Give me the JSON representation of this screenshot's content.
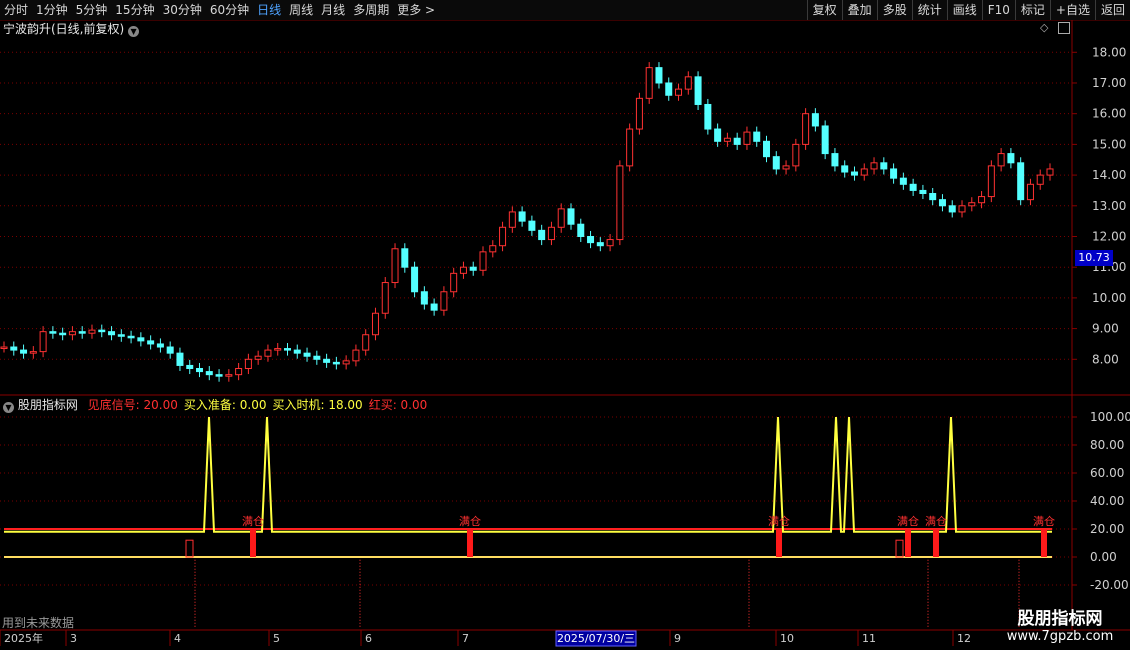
{
  "toolbar": {
    "periods": [
      "分时",
      "1分钟",
      "5分钟",
      "15分钟",
      "30分钟",
      "60分钟",
      "日线",
      "周线",
      "月线",
      "多周期",
      "更多 >"
    ],
    "active_period": "日线",
    "actions": [
      "复权",
      "叠加",
      "多股",
      "统计",
      "画线",
      "F10",
      "标记",
      "+自选",
      "返回"
    ]
  },
  "main_panel": {
    "title": "宁波韵升(日线,前复权)",
    "price_axis": [
      "18.00",
      "17.00",
      "16.00",
      "15.00",
      "14.00",
      "13.00",
      "12.00",
      "11.00",
      "10.00",
      "9.00",
      "8.00"
    ],
    "current_price_tag": "10.73"
  },
  "indicator_panel": {
    "name": "股朋指标网",
    "values": [
      {
        "label": "见底信号: 20.00",
        "color": "#ff3030"
      },
      {
        "label": "买入准备: 0.00",
        "color": "#ffff40"
      },
      {
        "label": "买入时机: 18.00",
        "color": "#ffff40"
      },
      {
        "label": "红买: 0.00",
        "color": "#ff3030"
      }
    ],
    "axis": [
      "100.00",
      "80.00",
      "60.00",
      "40.00",
      "20.00",
      "0.00",
      "-20.00"
    ],
    "signal_text": "满仓"
  },
  "date_axis": {
    "labels": [
      "2025年",
      "3",
      "4",
      "5",
      "6",
      "7",
      "9",
      "10",
      "11",
      "12"
    ],
    "cursor_date": "2025/07/30/三"
  },
  "footer": {
    "future_note": "用到未来数据"
  },
  "watermark": {
    "line1": "股朋指标网",
    "line2": "www.7gpzb.com"
  },
  "colors": {
    "up": "#ff3232",
    "down": "#54ffff",
    "axis": "#8a0000",
    "grid": "#7a0000",
    "signal_line": "#ffff40"
  },
  "chart_data": {
    "type": "candlestick",
    "title": "宁波韵升(日线,前复权)",
    "ylim": [
      7.0,
      18.4
    ],
    "close_series": [
      8.4,
      8.3,
      8.2,
      8.25,
      8.9,
      8.85,
      8.8,
      8.9,
      8.85,
      8.95,
      8.9,
      8.8,
      8.75,
      8.7,
      8.6,
      8.5,
      8.4,
      8.2,
      7.8,
      7.7,
      7.6,
      7.5,
      7.45,
      7.5,
      7.7,
      8.0,
      8.1,
      8.3,
      8.35,
      8.3,
      8.2,
      8.1,
      8.0,
      7.9,
      7.85,
      7.95,
      8.3,
      8.8,
      9.5,
      10.5,
      11.6,
      11.0,
      10.2,
      9.8,
      9.6,
      10.2,
      10.8,
      11.0,
      10.9,
      11.5,
      11.7,
      12.3,
      12.8,
      12.5,
      12.2,
      11.9,
      12.3,
      12.9,
      12.4,
      12.0,
      11.8,
      11.7,
      11.9,
      14.3,
      15.5,
      16.5,
      17.5,
      17.0,
      16.6,
      16.8,
      17.2,
      16.3,
      15.5,
      15.1,
      15.2,
      15.0,
      15.4,
      15.1,
      14.6,
      14.2,
      14.3,
      15.0,
      16.0,
      15.6,
      14.7,
      14.3,
      14.1,
      14.0,
      14.2,
      14.4,
      14.2,
      13.9,
      13.7,
      13.5,
      13.4,
      13.2,
      13.0,
      12.8,
      13.0,
      13.1,
      13.3,
      14.3,
      14.7,
      14.4,
      13.2,
      13.7,
      14.0,
      14.2
    ]
  }
}
